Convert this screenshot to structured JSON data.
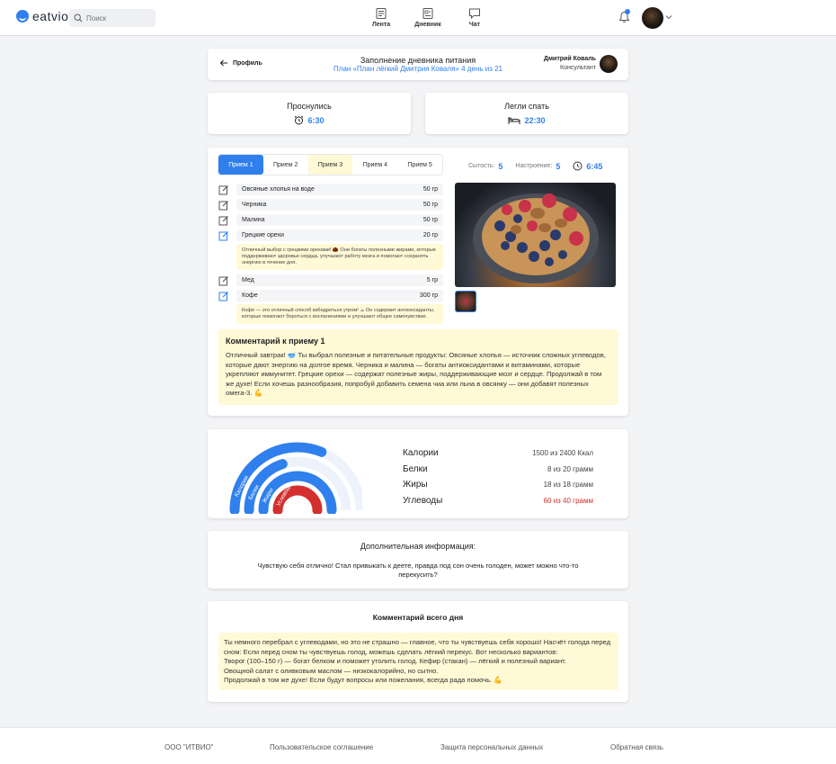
{
  "header": {
    "logo": "eatvio",
    "search_placeholder": "Поиск",
    "nav": [
      {
        "label": "Лента",
        "icon": "feed-icon"
      },
      {
        "label": "Дневник",
        "icon": "diary-icon"
      },
      {
        "label": "Чат",
        "icon": "chat-icon"
      }
    ],
    "notification_icon": "bell-icon"
  },
  "top_card": {
    "back_label": "Профиль",
    "title": "Заполнение дневника питания",
    "subtitle": "План «План лёгкий Дмитрия Коваля» 4 день из 21",
    "consultant_name": "Дмитрий Коваль",
    "consultant_role": "Консультант"
  },
  "woke": {
    "label": "Проснулись",
    "time": "6:30",
    "icon": "alarm-clock-icon"
  },
  "slept": {
    "label": "Легли спать",
    "time": "22:30",
    "icon": "bed-icon"
  },
  "meal": {
    "tabs": [
      {
        "label": "Прием 1",
        "state": "active"
      },
      {
        "label": "Прием 2",
        "state": "normal"
      },
      {
        "label": "Прием 3",
        "state": "highlight"
      },
      {
        "label": "Прием 4",
        "state": "normal"
      },
      {
        "label": "Прием 5",
        "state": "normal"
      }
    ],
    "satiety_label": "Сытость:",
    "satiety_value": "5",
    "mood_label": "Настроение:",
    "mood_value": "5",
    "time": "6:45",
    "items": [
      {
        "name": "Овсяные хлопья на воде",
        "amount": "50 гр",
        "edited": false
      },
      {
        "name": "Черника",
        "amount": "50 гр",
        "edited": false
      },
      {
        "name": "Малина",
        "amount": "50 гр",
        "edited": false
      },
      {
        "name": "Грецкие орехи",
        "amount": "20 гр",
        "edited": true
      },
      {
        "name": "Мед",
        "amount": "5 гр",
        "edited": false
      },
      {
        "name": "Кофе",
        "amount": "300 гр",
        "edited": true
      }
    ],
    "tip_nuts": "Отличный выбор с грецкими орехами! 🌰 Они богаты полезными жирами, которые поддерживают здоровье сердца, улучшают работу мозга и помогают сохранять энергию в течение дня.",
    "tip_coffee": "Кофе — это отличный способ взбодриться утром! ☕ Он содержит антиоксиданты, которые помогают бороться с воспалениями и улучшают общее самочувствие.",
    "comment_title": "Комментарий к приему 1",
    "comment_text": "Отличный завтрак! 🥣 Ты выбрал полезные и питательные продукты: Овсяные хлопья — источник сложных углеводов, которые дают энергию на долгое время. Черника и малина — богаты антиоксидантами и витаминами, которые укрепляют иммунитет. Грецкие орехи — содержат полезные жиры, поддерживающие мозг и сердце. Продолжай в том же духе! Если хочешь разнообразия, попробуй добавить семена чиа или льна в овсянку — они добавят полезных омега-3. 💪"
  },
  "nutrition": {
    "rows": [
      {
        "name": "Калории",
        "value": "1500 из 2400 Ккал",
        "fraction": 0.625,
        "color": "#2f80ed",
        "over": false
      },
      {
        "name": "Белки",
        "value": "8 из 20 грамм",
        "fraction": 0.4,
        "color": "#2f80ed",
        "over": false
      },
      {
        "name": "Жиры",
        "value": "18 из 18 грамм",
        "fraction": 1.0,
        "color": "#2f80ed",
        "over": false
      },
      {
        "name": "Углеводы",
        "value": "60 из 40 грамм",
        "fraction": 1.0,
        "color": "#d32f2f",
        "over": true
      }
    ]
  },
  "extra": {
    "title": "Дополнительная информация:",
    "text": "Чувствую себя отлично! Стал привыкать к деете, правда под сон очень голоден, может можно что-то перекусить?"
  },
  "day_comment": {
    "title": "Комментарий всего дня",
    "lines": [
      "Ты немного перебрал с углеводами, но это не страшно — главное, что ты чувствуешь себя хорошо! Насчёт голода перед сном: Если перед сном ты чувствуешь голод, можешь сделать лёгкий перекус. Вот несколько вариантов:",
      "Творог (100–150 г) — богат белком и поможет утолить голод. Кефир (стакан) — лёгкий и полезный вариант.",
      "Овощной салат с оливковым маслом — низкокалорийно, но сытно.",
      "Продолжай в том же духе! Если будут вопросы или пожелания, всегда рада помочь. 💪"
    ]
  },
  "footer": {
    "company": "ООО \"ИТВИО\"",
    "agreement": "Пользовательское соглашение",
    "privacy": "Защита персональных данных",
    "feedback": "Обратная связь"
  }
}
